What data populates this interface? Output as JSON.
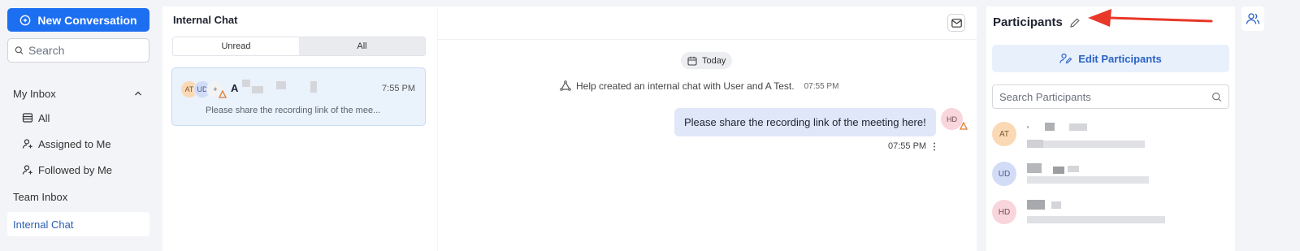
{
  "sidebar": {
    "new_conversation_label": "New Conversation",
    "search_placeholder": "Search",
    "my_inbox_label": "My Inbox",
    "items": [
      {
        "label": "All",
        "icon": "inbox-stack-icon"
      },
      {
        "label": "Assigned to Me",
        "icon": "user-plus-icon"
      },
      {
        "label": "Followed by Me",
        "icon": "user-plus-icon"
      }
    ],
    "team_inbox_label": "Team Inbox",
    "internal_chat_label": "Internal Chat"
  },
  "list": {
    "title": "Internal Chat",
    "tabs": [
      {
        "label": "Unread",
        "active": false
      },
      {
        "label": "All",
        "active": true
      }
    ],
    "conversation": {
      "avatars": [
        "AT",
        "UD",
        "+"
      ],
      "name_initial": "A",
      "time": "7:55 PM",
      "preview": "Please share the recording link of the mee..."
    }
  },
  "chat": {
    "date_label": "Today",
    "system_message": "Help created an internal chat with User and A Test.",
    "system_time": "07:55 PM",
    "message": "Please share the recording link of the meeting here!",
    "message_avatar": "HD",
    "message_time": "07:55 PM"
  },
  "participants": {
    "title": "Participants",
    "edit_label": "Edit Participants",
    "search_placeholder": "Search Participants",
    "list": [
      {
        "initials": "AT",
        "color": "#fbd9b4",
        "text_color": "#7a5a36"
      },
      {
        "initials": "UD",
        "color": "#d3dcf7",
        "text_color": "#4a5a8a"
      },
      {
        "initials": "HD",
        "color": "#f9d5dc",
        "text_color": "#7a4a55"
      }
    ]
  },
  "colors": {
    "primary": "#1d6ff2",
    "annotation_arrow": "#e8382a"
  }
}
